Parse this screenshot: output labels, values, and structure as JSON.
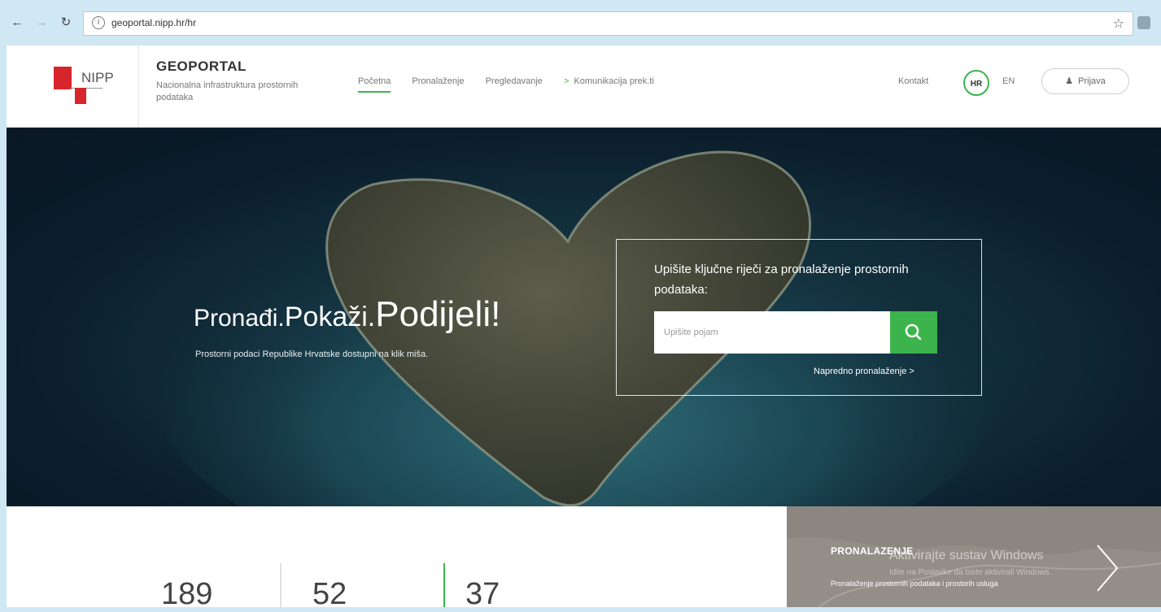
{
  "browser": {
    "url": "geoportal.nipp.hr/hr"
  },
  "header": {
    "logo_text": "NIPP",
    "brand_title": "GEOPORTAL",
    "brand_subtitle": "Nacionalna infrastruktura prostornih podataka",
    "nav": [
      {
        "label": "Početna",
        "active": true
      },
      {
        "label": "Pronalaženje"
      },
      {
        "label": "Pregledavanje"
      },
      {
        "label": "Komunikacija prek.ti"
      }
    ],
    "kontakt": "Kontakt",
    "lang_hr": "HR",
    "lang_en": "EN",
    "login": "Prijava"
  },
  "hero": {
    "headline_a": "Pronađi.",
    "headline_b": "Pokaži.",
    "headline_c": "Podijeli!",
    "tagline": "Prostorni podaci Republike Hrvatske dostupni na klik miša.",
    "search_prompt": "Upišite ključne riječi za pronalaženje prostornih podataka:",
    "search_placeholder": "Upišite pojam",
    "advanced_search": "Napredno pronalaženje >"
  },
  "stats": [
    {
      "value": "189"
    },
    {
      "value": "52"
    },
    {
      "value": "37"
    }
  ],
  "promo": {
    "title": "PRONALAZENJE",
    "description": "Pronalaženje prostornih podataka i prostorih usluga",
    "watermark_title": "Aktivirajte sustav Windows",
    "watermark_sub": "Idite na Postavke da biste aktivirali Windows."
  },
  "colors": {
    "accent_green": "#3cb44b",
    "logo_red": "#d6252b",
    "chrome_bg": "#cfe8f4",
    "promo_bg": "#8c8680"
  }
}
